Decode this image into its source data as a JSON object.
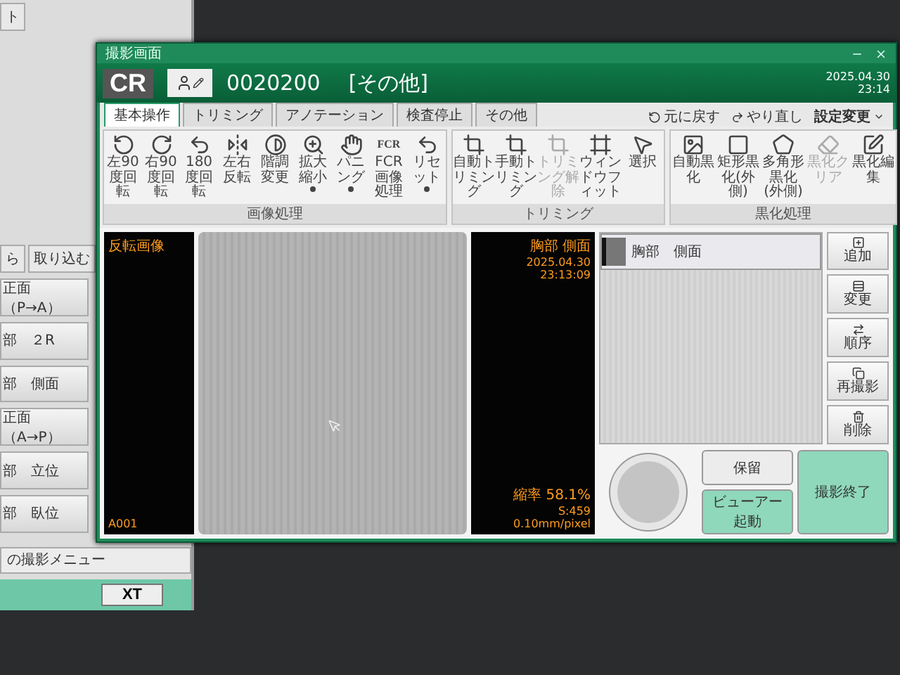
{
  "background_app": {
    "top_tab": "ト",
    "tabs": [
      {
        "label": "ら",
        "selected": false
      },
      {
        "label": "取り込む",
        "selected": false
      }
    ],
    "menu_items": [
      "正面（P→A）",
      "部　２R",
      "部　側面",
      "正面（A→P）",
      "部　立位",
      "部　臥位"
    ],
    "other_menu": "の撮影メニュー",
    "bottom_button": "XT"
  },
  "window": {
    "title": "撮影画面"
  },
  "header": {
    "logo": "CR",
    "exam_id": "0020200",
    "category": "[その他]",
    "date": "2025.04.30",
    "time": "23:14"
  },
  "tabs": [
    {
      "label": "基本操作",
      "selected": true
    },
    {
      "label": "トリミング",
      "selected": false
    },
    {
      "label": "アノテーション",
      "selected": false
    },
    {
      "label": "検査停止",
      "selected": false
    },
    {
      "label": "その他",
      "selected": false
    }
  ],
  "actions": [
    {
      "label": "元に戻す",
      "kind": "undo"
    },
    {
      "label": "やり直し",
      "kind": "redo"
    },
    {
      "label": "設定変更",
      "kind": "menu"
    }
  ],
  "ribbon": [
    {
      "label": "画像処理",
      "buttons": [
        {
          "label": "左90度回転",
          "disabled": false,
          "menu": false
        },
        {
          "label": "右90度回転",
          "disabled": false,
          "menu": false
        },
        {
          "label": "180度回転",
          "disabled": false,
          "menu": false
        },
        {
          "label": "左右反転",
          "disabled": false,
          "menu": false
        },
        {
          "label": "階調変更",
          "disabled": false,
          "menu": false
        },
        {
          "label": "拡大縮小",
          "disabled": false,
          "menu": true
        },
        {
          "label": "パニング",
          "disabled": false,
          "menu": true
        },
        {
          "label": "FCR画像処理",
          "disabled": false,
          "menu": false,
          "icon_text": "FCR"
        },
        {
          "label": "リセット",
          "disabled": false,
          "menu": true
        }
      ]
    },
    {
      "label": "トリミング",
      "buttons": [
        {
          "label": "自動トリミング",
          "disabled": false,
          "menu": false
        },
        {
          "label": "手動トリミング",
          "disabled": false,
          "menu": false
        },
        {
          "label": "トリミング解除",
          "disabled": true,
          "menu": false
        },
        {
          "label": "ウィンドウフィット",
          "disabled": false,
          "menu": false
        },
        {
          "label": "選択",
          "disabled": false,
          "menu": false
        }
      ]
    },
    {
      "label": "黒化処理",
      "buttons": [
        {
          "label": "自動黒化",
          "disabled": false,
          "menu": false
        },
        {
          "label": "矩形黒化(外側)",
          "disabled": false,
          "menu": false
        },
        {
          "label": "多角形黒化(外側)",
          "disabled": false,
          "menu": false
        },
        {
          "label": "黒化クリア",
          "disabled": true,
          "menu": false
        },
        {
          "label": "黒化編集",
          "disabled": false,
          "menu": false
        }
      ]
    }
  ],
  "viewer": {
    "left_top": "反転画像",
    "left_bottom": "A001",
    "right_top": [
      "胸部 側面",
      "2025.04.30 23:13:09"
    ],
    "right_bottom": [
      "縮率 58.1%",
      "S:459",
      "0.10mm/pixel"
    ]
  },
  "series": [
    {
      "label": "胸部　側面",
      "selected": true
    }
  ],
  "side_buttons": [
    "追加",
    "変更",
    "順序",
    "再撮影",
    "削除"
  ],
  "bottom": {
    "hold": "保留",
    "viewer": "ビューアー起動",
    "finish": "撮影終了"
  }
}
